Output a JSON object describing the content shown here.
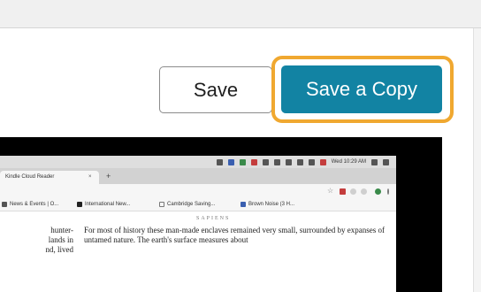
{
  "dialog": {
    "save_label": "Save",
    "save_copy_label": "Save a Copy",
    "accent_color": "#1283a3",
    "highlight_color": "#f0a830"
  },
  "embedded_screenshot": {
    "menubar": {
      "icons": [
        "screen-icon",
        "dropbox-icon",
        "photo-icon",
        "red-app-icon",
        "crop-icon",
        "sync-icon",
        "volume-icon",
        "time-machine-icon",
        "bluetooth-icon",
        "flag-icon",
        "search-icon",
        "menu-list-icon"
      ],
      "clock": "Wed 10:29 AM"
    },
    "tab": {
      "title": "Kindle Cloud Reader",
      "close": "×",
      "new_tab": "+"
    },
    "bookmarks": [
      "News & Events | O...",
      "International New...",
      "Cambridge Saving...",
      "Brown Noise (3 H..."
    ],
    "book": {
      "running_title": "SAPIENS",
      "left_column": [
        "hunter-",
        "lands in",
        "nd, lived"
      ],
      "right_column": "For most of history these man-made enclaves remained very small, surrounded by expanses of untamed nature. The earth's surface measures about"
    }
  }
}
